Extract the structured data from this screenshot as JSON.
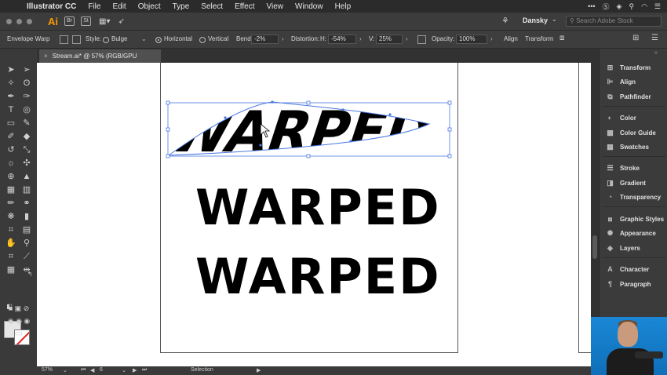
{
  "menubar": {
    "apple": "",
    "app_name": "Illustrator CC",
    "items": [
      "File",
      "Edit",
      "Object",
      "Type",
      "Select",
      "Effect",
      "View",
      "Window",
      "Help"
    ]
  },
  "appbar": {
    "logo": "Ai",
    "bridge": "Br",
    "stock": "St",
    "workspace": "Dansky",
    "search_placeholder": "Search Adobe Stock"
  },
  "controlbar": {
    "tool_label": "Envelope Warp",
    "style_label": "Style:",
    "style_value": "Bulge",
    "horizontal_label": "Horizontal",
    "vertical_label": "Vertical",
    "bend_label": "Bend:",
    "bend_value": "-2%",
    "distortion_label": "Distortion:",
    "h_label": "H:",
    "h_value": "-54%",
    "v_label": "V:",
    "v_value": "25%",
    "opacity_label": "Opacity:",
    "opacity_value": "100%",
    "align_label": "Align",
    "transform_label": "Transform"
  },
  "doctab": {
    "title": "Stream.ai* @ 57% (RGB/GPU Preview)"
  },
  "canvas": {
    "warped_text": "WARPED",
    "text_2": "WARPED",
    "text_3": "WARPED"
  },
  "statusbar": {
    "zoom": "57%",
    "page": "6",
    "status": "Selection"
  },
  "panel": {
    "items": [
      "Transform",
      "Align",
      "Pathfinder",
      "Color",
      "Color Guide",
      "Swatches",
      "Stroke",
      "Gradient",
      "Transparency",
      "Graphic Styles",
      "Appearance",
      "Layers",
      "Character",
      "Paragraph"
    ]
  },
  "colors": {
    "selection": "#4a78e0",
    "ai_orange": "#ff9a00",
    "stroke_none_red": "#e02020"
  }
}
